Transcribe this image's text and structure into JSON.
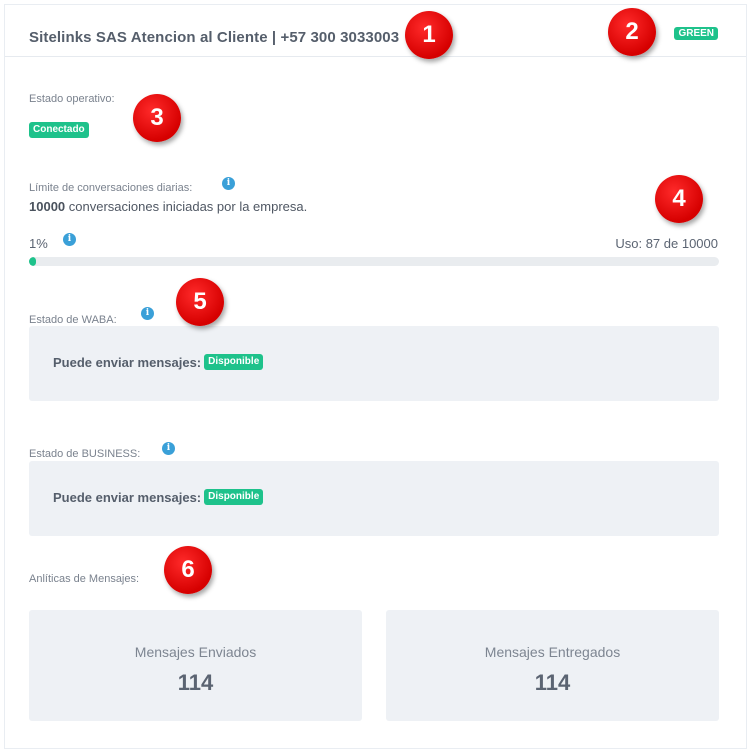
{
  "header": {
    "title": "Sitelinks SAS Atencion al Cliente | +57 300 3033003",
    "quality_badge": "GREEN"
  },
  "operational_status": {
    "label": "Estado operativo:",
    "badge": "Conectado"
  },
  "conversation_limit": {
    "label": "Límite de conversaciones diarias:",
    "limit_value": "10000",
    "limit_text": "conversaciones iniciadas por la empresa.",
    "percent_label": "1%",
    "usage_label": "Uso: 87 de 10000",
    "usage_fraction": 0.0087
  },
  "waba_status": {
    "label": "Estado de WABA:",
    "message_label": "Puede enviar mensajes:",
    "badge": "Disponible"
  },
  "business_status": {
    "label": "Estado de BUSINESS:",
    "message_label": "Puede enviar mensajes:",
    "badge": "Disponible"
  },
  "analytics": {
    "label": "Anlíticas de Mensajes:",
    "sent_title": "Mensajes Enviados",
    "sent_value": "114",
    "delivered_title": "Mensajes Entregados",
    "delivered_value": "114"
  },
  "markers": [
    "1",
    "2",
    "3",
    "4",
    "5",
    "6"
  ],
  "colors": {
    "accent_green": "#1ec28b",
    "info_blue": "#3aa0d8",
    "marker_red": "#e00000"
  },
  "icons": {
    "info": "info-icon"
  }
}
